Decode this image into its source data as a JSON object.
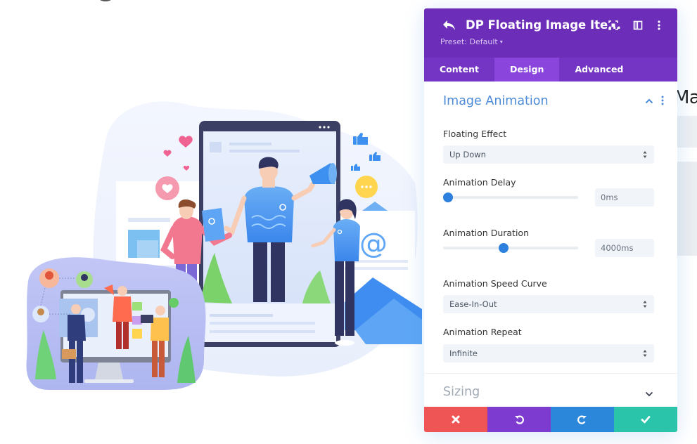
{
  "page": {
    "right_heading_fragment": "Mar"
  },
  "illustration": {
    "description": "Social media marketing illustration",
    "colors": {
      "blob": "#eef3fd",
      "device_frame": "#3b3f64",
      "accent_blue": "#3d8ff0",
      "pink": "#f06292",
      "green": "#66cc66",
      "yellow": "#ffd54f",
      "lavender": "#b9c0f4"
    }
  },
  "panel": {
    "title": "DP Floating Image Ite...",
    "preset_label": "Preset: Default",
    "tabs": [
      {
        "label": "Content",
        "active": false
      },
      {
        "label": "Design",
        "active": true
      },
      {
        "label": "Advanced",
        "active": false
      }
    ],
    "section": {
      "title": "Image Animation",
      "fields": {
        "floating_effect": {
          "label": "Floating Effect",
          "value": "Up Down"
        },
        "animation_delay": {
          "label": "Animation Delay",
          "value": "0ms",
          "fraction": 0.0
        },
        "animation_duration": {
          "label": "Animation Duration",
          "value": "4000ms",
          "fraction": 0.45
        },
        "speed_curve": {
          "label": "Animation Speed Curve",
          "value": "Ease-In-Out"
        },
        "repeat": {
          "label": "Animation Repeat",
          "value": "Infinite"
        }
      }
    },
    "collapsed_section": {
      "title": "Sizing"
    },
    "footer": {
      "cancel": {
        "icon": "close-icon",
        "color": "#ef5555"
      },
      "undo": {
        "icon": "undo-icon",
        "color": "#7e3bd0"
      },
      "redo": {
        "icon": "redo-icon",
        "color": "#2b87da"
      },
      "save": {
        "icon": "check-icon",
        "color": "#29c4a9"
      }
    },
    "colors": {
      "header": "#6c2eb9",
      "tab_active": "#8a46dc",
      "section_title": "#4c8bd6",
      "slider_thumb": "#2d80dd"
    }
  }
}
